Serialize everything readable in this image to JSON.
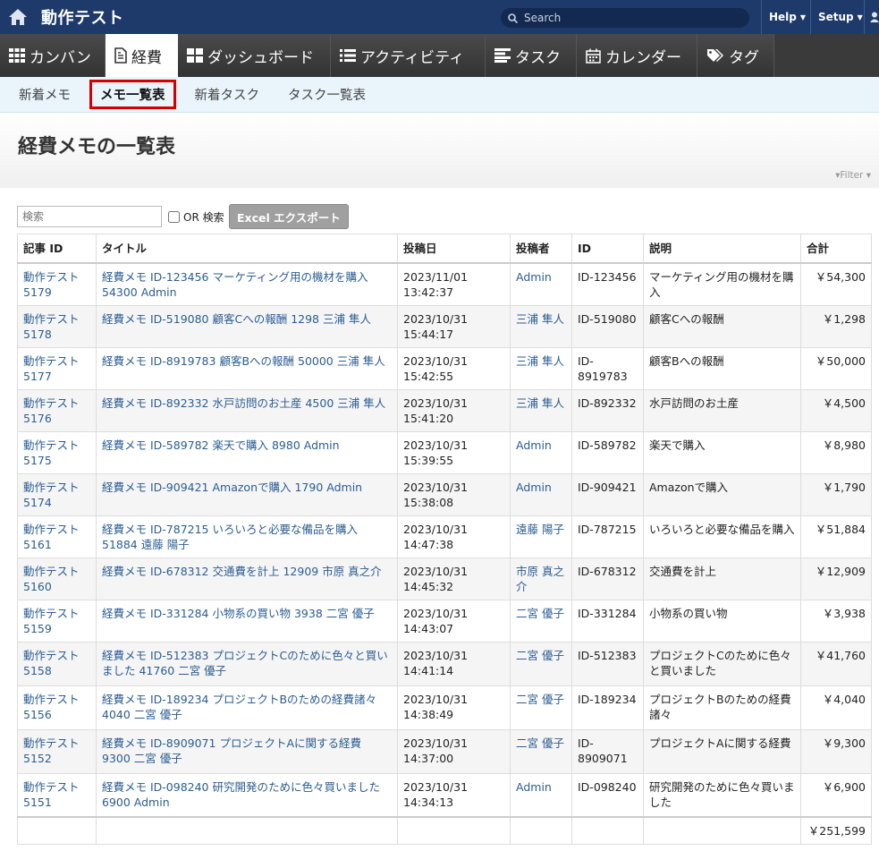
{
  "header": {
    "title": "動作テスト",
    "search_placeholder": "Search",
    "help_label": "Help",
    "setup_label": "Setup"
  },
  "tabs": [
    {
      "label": "カンバン",
      "icon": "grid-icon"
    },
    {
      "label": "経費",
      "icon": "document-icon"
    },
    {
      "label": "ダッシュボード",
      "icon": "dashboard-icon"
    },
    {
      "label": "アクティビティ",
      "icon": "list-icon"
    },
    {
      "label": "タスク",
      "icon": "task-icon"
    },
    {
      "label": "カレンダー",
      "icon": "calendar-icon"
    },
    {
      "label": "タグ",
      "icon": "tag-icon"
    }
  ],
  "subnav": [
    "新着メモ",
    "メモ一覧表",
    "新着タスク",
    "タスク一覧表"
  ],
  "page": {
    "title": "経費メモの一覧表",
    "filter_label": "Filter"
  },
  "toolbar": {
    "search_placeholder": "検索",
    "or_label": "OR 検索",
    "export_label": "Excel エクスポート"
  },
  "table": {
    "columns": [
      "記事 ID",
      "タイトル",
      "投稿日",
      "投稿者",
      "ID",
      "説明",
      "合計"
    ],
    "rows": [
      {
        "article": "動作テスト 5179",
        "title": "経費メモ ID-123456 マーケティング用の機材を購入 54300 Admin",
        "date": "2023/11/01 13:42:37",
        "author": "Admin",
        "id": "ID-123456",
        "desc": "マーケティング用の機材を購入",
        "total": "￥54,300"
      },
      {
        "article": "動作テスト 5178",
        "title": "経費メモ ID-519080 顧客Cへの報酬 1298 三浦 隼人",
        "date": "2023/10/31 15:44:17",
        "author": "三浦 隼人",
        "id": "ID-519080",
        "desc": "顧客Cへの報酬",
        "total": "￥1,298"
      },
      {
        "article": "動作テスト 5177",
        "title": "経費メモ ID-8919783 顧客Bへの報酬 50000 三浦 隼人",
        "date": "2023/10/31 15:42:55",
        "author": "三浦 隼人",
        "id": "ID-8919783",
        "desc": "顧客Bへの報酬",
        "total": "￥50,000"
      },
      {
        "article": "動作テスト 5176",
        "title": "経費メモ ID-892332 水戸訪問のお土産 4500 三浦 隼人",
        "date": "2023/10/31 15:41:20",
        "author": "三浦 隼人",
        "id": "ID-892332",
        "desc": "水戸訪問のお土産",
        "total": "￥4,500"
      },
      {
        "article": "動作テスト 5175",
        "title": "経費メモ ID-589782 楽天で購入 8980 Admin",
        "date": "2023/10/31 15:39:55",
        "author": "Admin",
        "id": "ID-589782",
        "desc": "楽天で購入",
        "total": "￥8,980"
      },
      {
        "article": "動作テスト 5174",
        "title": "経費メモ ID-909421 Amazonで購入 1790 Admin",
        "date": "2023/10/31 15:38:08",
        "author": "Admin",
        "id": "ID-909421",
        "desc": "Amazonで購入",
        "total": "￥1,790"
      },
      {
        "article": "動作テスト 5161",
        "title": "経費メモ ID-787215 いろいろと必要な備品を購入 51884 遠藤 陽子",
        "date": "2023/10/31 14:47:38",
        "author": "遠藤 陽子",
        "id": "ID-787215",
        "desc": "いろいろと必要な備品を購入",
        "total": "￥51,884"
      },
      {
        "article": "動作テスト 5160",
        "title": "経費メモ ID-678312 交通費を計上 12909 市原 真之介",
        "date": "2023/10/31 14:45:32",
        "author": "市原 真之介",
        "id": "ID-678312",
        "desc": "交通費を計上",
        "total": "￥12,909"
      },
      {
        "article": "動作テスト 5159",
        "title": "経費メモ ID-331284 小物系の買い物 3938 二宮 優子",
        "date": "2023/10/31 14:43:07",
        "author": "二宮 優子",
        "id": "ID-331284",
        "desc": "小物系の買い物",
        "total": "￥3,938"
      },
      {
        "article": "動作テスト 5158",
        "title": "経費メモ ID-512383 プロジェクトCのために色々と買いました 41760 二宮 優子",
        "date": "2023/10/31 14:41:14",
        "author": "二宮 優子",
        "id": "ID-512383",
        "desc": "プロジェクトCのために色々と買いました",
        "total": "￥41,760"
      },
      {
        "article": "動作テスト 5156",
        "title": "経費メモ ID-189234 プロジェクトBのための経費諸々 4040 二宮 優子",
        "date": "2023/10/31 14:38:49",
        "author": "二宮 優子",
        "id": "ID-189234",
        "desc": "プロジェクトBのための経費諸々",
        "total": "￥4,040"
      },
      {
        "article": "動作テスト 5152",
        "title": "経費メモ ID-8909071 プロジェクトAに関する経費 9300 二宮 優子",
        "date": "2023/10/31 14:37:00",
        "author": "二宮 優子",
        "id": "ID-8909071",
        "desc": "プロジェクトAに関する経費",
        "total": "￥9,300"
      },
      {
        "article": "動作テスト 5151",
        "title": "経費メモ ID-098240 研究開発のために色々買いました 6900 Admin",
        "date": "2023/10/31 14:34:13",
        "author": "Admin",
        "id": "ID-098240",
        "desc": "研究開発のために色々買いました",
        "total": "￥6,900"
      }
    ],
    "grand_total": "￥251,599"
  }
}
